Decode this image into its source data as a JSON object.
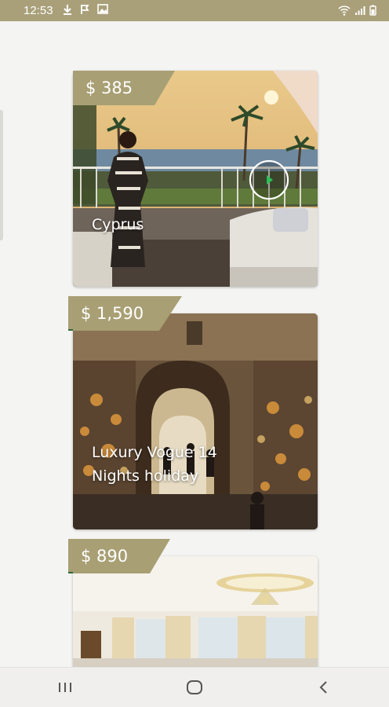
{
  "status_bar": {
    "time": "12:53"
  },
  "cards": [
    {
      "title": "Cyprus",
      "price": "$ 385"
    },
    {
      "title": "Luxury Vogue 14 Nights holiday",
      "price": "$ 1,590"
    },
    {
      "title": "",
      "price": "$ 890"
    }
  ],
  "colors": {
    "accent": "#a89f74",
    "status_bar": "#a9a07a",
    "background": "#f4f4f2"
  }
}
